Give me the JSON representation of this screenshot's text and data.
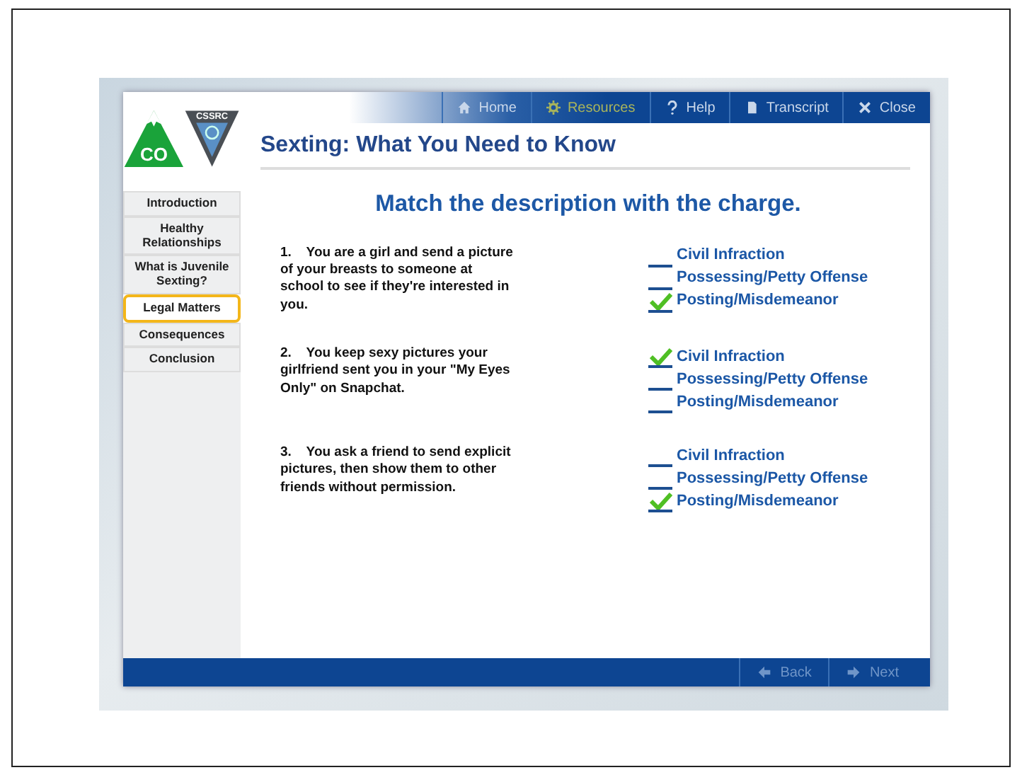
{
  "logo": {
    "state": "CO",
    "org": "CSSRC"
  },
  "toolbar": [
    {
      "label": "Home",
      "kind": "home",
      "selected": false
    },
    {
      "label": "Resources",
      "kind": "gear",
      "selected": true
    },
    {
      "label": "Help",
      "kind": "help",
      "selected": false
    },
    {
      "label": "Transcript",
      "kind": "doc",
      "selected": false
    },
    {
      "label": "Close",
      "kind": "close",
      "selected": false
    }
  ],
  "title": "Sexting: What You Need to Know",
  "sidebar": [
    {
      "label": "Introduction",
      "selected": false
    },
    {
      "label": "Healthy Relationships",
      "selected": false
    },
    {
      "label": "What is Juvenile Sexting?",
      "selected": false
    },
    {
      "label": "Legal Matters",
      "selected": true
    },
    {
      "label": "Consequences",
      "selected": false
    },
    {
      "label": "Conclusion",
      "selected": false
    }
  ],
  "heading": "Match the description with the charge.",
  "questions": [
    {
      "number": "1.",
      "text": "You are a girl and send a picture of your breasts to someone at school to see if they're interested in you.",
      "options": [
        {
          "label": "Civil Infraction",
          "checked": false
        },
        {
          "label": "Possessing/Petty Offense",
          "checked": false
        },
        {
          "label": "Posting/Misdemeanor",
          "checked": true
        }
      ]
    },
    {
      "number": "2.",
      "text": "You keep sexy pictures your girlfriend sent you in your \"My Eyes Only\" on Snapchat.",
      "options": [
        {
          "label": "Civil Infraction",
          "checked": true
        },
        {
          "label": "Possessing/Petty Offense",
          "checked": false
        },
        {
          "label": "Posting/Misdemeanor",
          "checked": false
        }
      ]
    },
    {
      "number": "3.",
      "text": "You ask a friend to send explicit pictures, then show them to other friends without permission.",
      "options": [
        {
          "label": "Civil Infraction",
          "checked": false
        },
        {
          "label": "Possessing/Petty Offense",
          "checked": false
        },
        {
          "label": "Posting/Misdemeanor",
          "checked": true
        }
      ]
    }
  ],
  "footer": [
    {
      "label": "Back",
      "kind": "left"
    },
    {
      "label": "Next",
      "kind": "right"
    }
  ]
}
